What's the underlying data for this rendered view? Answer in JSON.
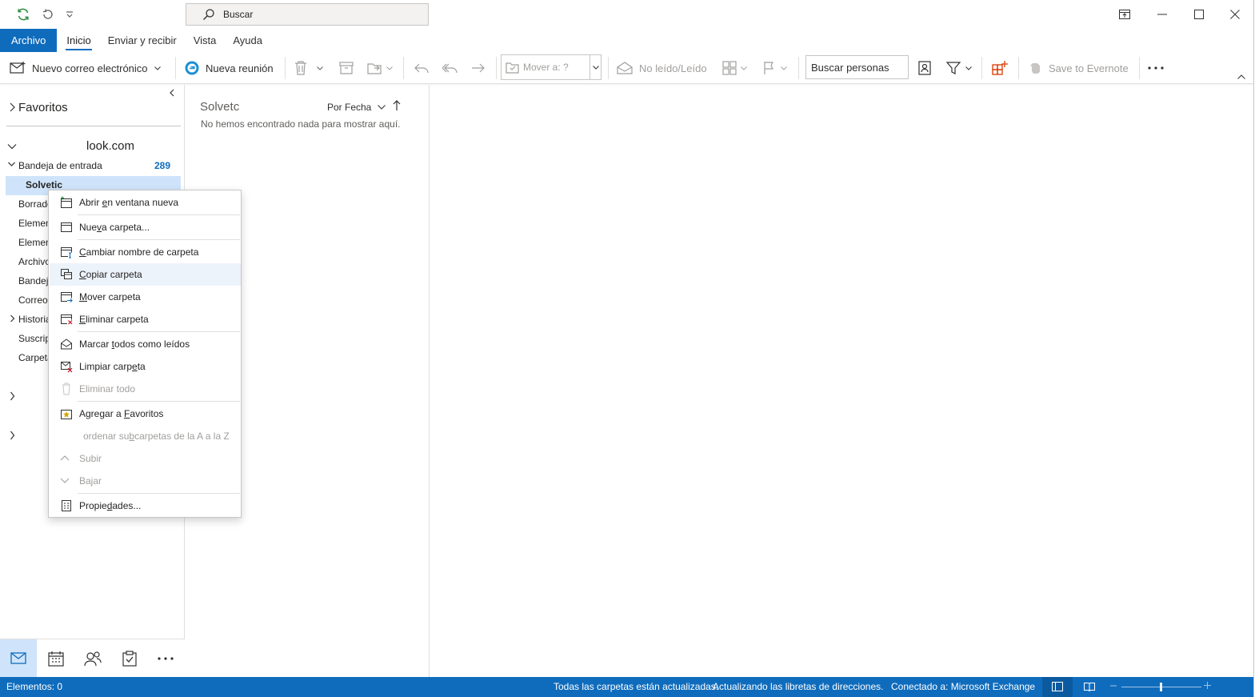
{
  "titlebar": {
    "search_placeholder": "Buscar",
    "icons": [
      "sync-icon",
      "undo-icon",
      "customize-quick-access-icon",
      "ribbon-display-options-icon",
      "minimize-icon",
      "maximize-icon",
      "close-icon"
    ]
  },
  "ribbon_tabs": [
    "Archivo",
    "Inicio",
    "Enviar y recibir",
    "Vista",
    "Ayuda"
  ],
  "ribbon": {
    "new_email": "Nuevo correo electrónico",
    "new_meeting": "Nueva reunión",
    "move_to": "Mover a: ?",
    "unread_read": "No leído/Leído",
    "search_people": "Buscar personas",
    "save_evernote": "Save to Evernote"
  },
  "folders": {
    "favorites": "Favoritos",
    "account": "look.com",
    "inbox": "Bandeja de entrada",
    "inbox_count": "289",
    "items": [
      "Solvetic",
      "Borrado",
      "Elemen",
      "Elemen",
      "Archivo",
      "Bandej",
      "Correo",
      "Historia",
      "Suscrip",
      "Carpeta"
    ]
  },
  "message_list": {
    "folder_name": "Solvetc",
    "sort_label": "Por Fecha",
    "empty_text": "No hemos encontrado nada para mostrar aquí."
  },
  "context_menu": [
    {
      "pre": "Abrir ",
      "u": "e",
      "post": "n ventana nueva",
      "icon": "open-new-window-icon",
      "enabled": true
    },
    {
      "pre": "Nue",
      "u": "v",
      "post": "a carpeta...",
      "icon": "new-folder-icon",
      "enabled": true
    },
    {
      "pre": "",
      "u": "C",
      "post": "ambiar nombre de carpeta",
      "icon": "rename-folder-icon",
      "enabled": true
    },
    {
      "pre": "",
      "u": "C",
      "post": "opiar carpeta",
      "icon": "copy-folder-icon",
      "enabled": true
    },
    {
      "pre": "",
      "u": "M",
      "post": "over carpeta",
      "icon": "move-folder-icon",
      "enabled": true
    },
    {
      "pre": "",
      "u": "E",
      "post": "liminar carpeta",
      "icon": "delete-folder-icon",
      "enabled": true
    },
    {
      "pre": "Marcar ",
      "u": "t",
      "post": "odos como leídos",
      "icon": "mark-all-read-icon",
      "enabled": true
    },
    {
      "pre": "Limpiar carp",
      "u": "e",
      "post": "ta",
      "icon": "clean-up-folder-icon",
      "enabled": true
    },
    {
      "pre": "Eliminar todo",
      "u": "",
      "post": "",
      "icon": "delete-all-icon",
      "enabled": false
    },
    {
      "pre": "Agregar a ",
      "u": "F",
      "post": "avoritos",
      "icon": "add-favorite-icon",
      "enabled": true
    },
    {
      "pre": "ordenar su",
      "u": "b",
      "post": "carpetas de la A a la Z",
      "icon": "",
      "enabled": false
    },
    {
      "pre": "Subir",
      "u": "",
      "post": "",
      "icon": "chevron-up-icon",
      "enabled": false
    },
    {
      "pre": "Bajar",
      "u": "",
      "post": "",
      "icon": "chevron-down-icon",
      "enabled": false
    },
    {
      "pre": "Propie",
      "u": "d",
      "post": "ades...",
      "icon": "properties-icon",
      "enabled": true
    }
  ],
  "status": {
    "items": "Elementos: 0",
    "sync": "Todas las carpetas están actualizadas.",
    "address_book": "Actualizando las libretas de direcciones.",
    "connection": "Conectado a: Microsoft Exchange"
  },
  "colors": {
    "accent": "#0f6cbd",
    "selection": "#cfe4fa",
    "menu_hover": "#edf3fb",
    "disabled_text": "#a19f9d",
    "sync_green": "#2b8a3e",
    "delete_red": "#c50f1f"
  }
}
